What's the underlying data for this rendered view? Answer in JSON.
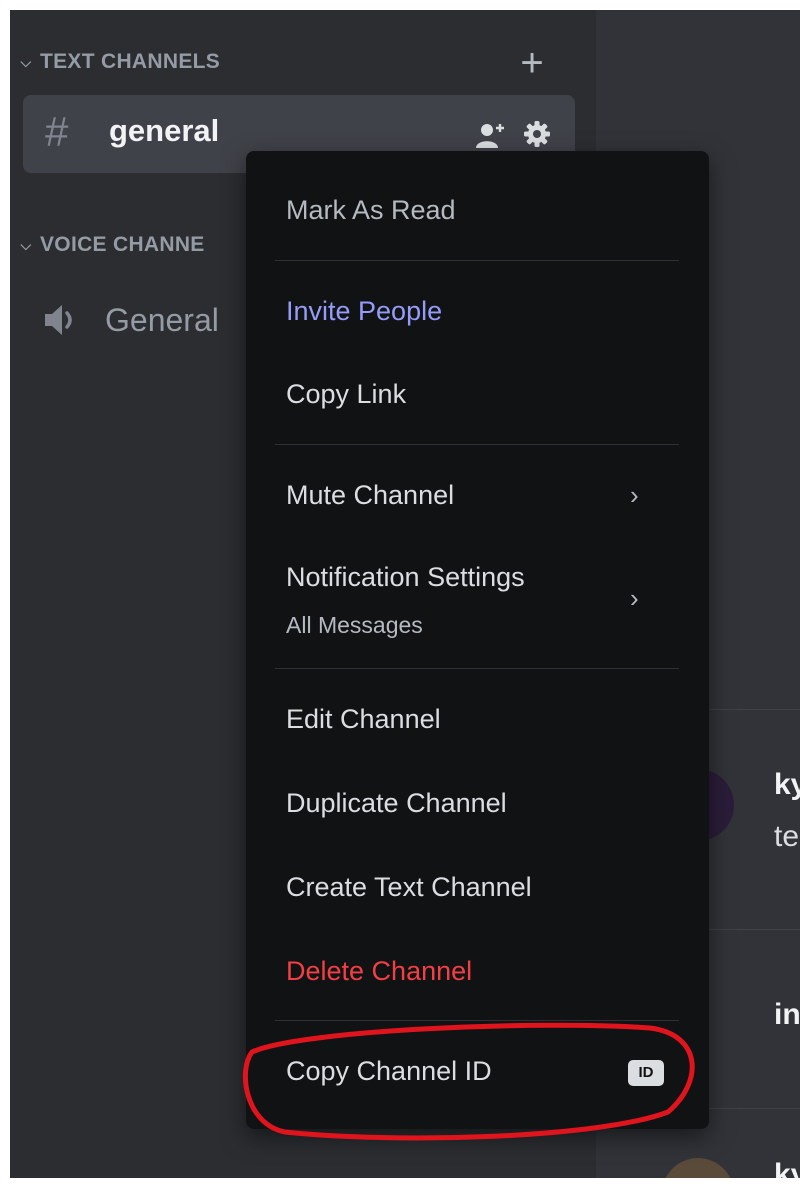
{
  "sidebar": {
    "text_category": "TEXT CHANNELS",
    "voice_category": "VOICE CHANNE",
    "active_channel": "general",
    "voice_channel": "General"
  },
  "main": {
    "message1_user": "ky",
    "message1_text": "te",
    "message2_user": "in",
    "message3_user": "ky"
  },
  "context_menu": {
    "mark_as_read": "Mark As Read",
    "invite_people": "Invite People",
    "copy_link": "Copy Link",
    "mute_channel": "Mute Channel",
    "notification_settings": "Notification Settings",
    "notification_value": "All Messages",
    "edit_channel": "Edit Channel",
    "duplicate_channel": "Duplicate Channel",
    "create_text_channel": "Create Text Channel",
    "delete_channel": "Delete Channel",
    "copy_channel_id": "Copy Channel ID",
    "id_badge": "ID"
  },
  "icons": {
    "category_chevron": "chevron-down-icon",
    "add_channel": "plus-icon",
    "text_channel": "hash-icon",
    "invite": "add-member-icon",
    "settings": "gear-icon",
    "voice_channel": "speaker-icon",
    "submenu": "chevron-right-icon",
    "copy_id": "id-badge-icon"
  },
  "colors": {
    "sidebar_bg": "#2b2d31",
    "main_bg": "#313338",
    "menu_bg": "#111214",
    "accent_blue": "#949cf7",
    "danger_red": "#f23f43",
    "annotation_red": "#e0141c"
  }
}
